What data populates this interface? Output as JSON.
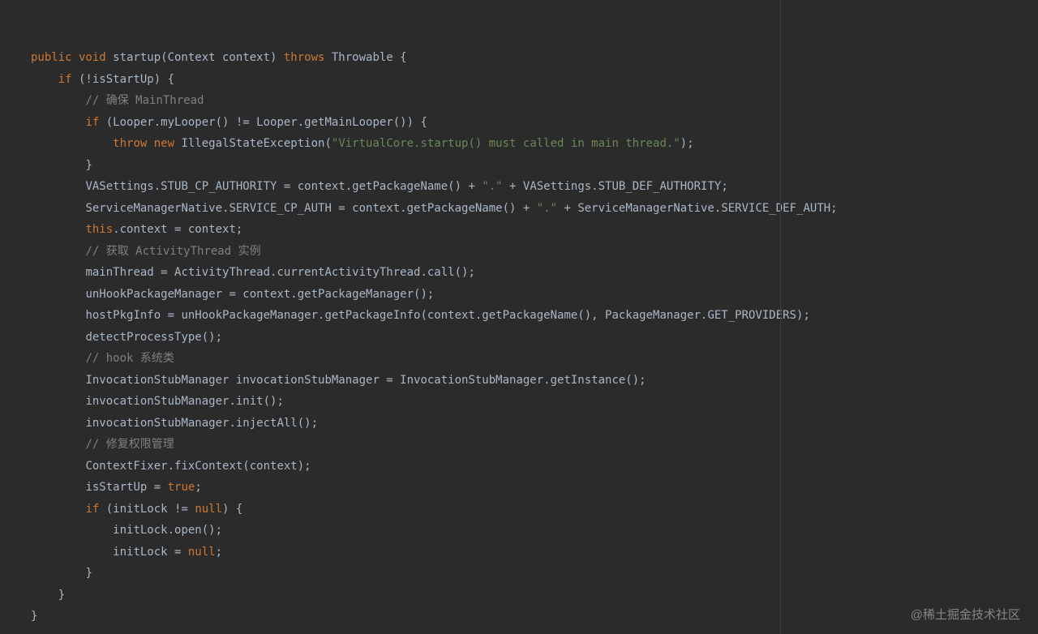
{
  "code": {
    "lines": [
      {
        "i": 0,
        "spans": [
          {
            "c": "kw",
            "t": "public void"
          },
          {
            "c": "id",
            "t": " startup(Context context) "
          },
          {
            "c": "kw",
            "t": "throws"
          },
          {
            "c": "id",
            "t": " Throwable {"
          }
        ]
      },
      {
        "i": 1,
        "spans": [
          {
            "c": "kw",
            "t": "if"
          },
          {
            "c": "id",
            "t": " (!isStartUp) {"
          }
        ]
      },
      {
        "i": 2,
        "spans": [
          {
            "c": "cmt",
            "t": "// 确保 MainThread"
          }
        ]
      },
      {
        "i": 2,
        "spans": [
          {
            "c": "kw",
            "t": "if"
          },
          {
            "c": "id",
            "t": " (Looper.myLooper() != Looper.getMainLooper()) {"
          }
        ]
      },
      {
        "i": 3,
        "spans": [
          {
            "c": "kw",
            "t": "throw new"
          },
          {
            "c": "id",
            "t": " IllegalStateException("
          },
          {
            "c": "str",
            "t": "\"VirtualCore.startup() must called in main thread.\""
          },
          {
            "c": "id",
            "t": ");"
          }
        ]
      },
      {
        "i": 2,
        "spans": [
          {
            "c": "id",
            "t": "}"
          }
        ]
      },
      {
        "i": 2,
        "spans": [
          {
            "c": "id",
            "t": "VASettings.STUB_CP_AUTHORITY = context.getPackageName() + "
          },
          {
            "c": "str",
            "t": "\".\""
          },
          {
            "c": "id",
            "t": " + VASettings.STUB_DEF_AUTHORITY;"
          }
        ]
      },
      {
        "i": 2,
        "spans": [
          {
            "c": "id",
            "t": "ServiceManagerNative.SERVICE_CP_AUTH = context.getPackageName() + "
          },
          {
            "c": "str",
            "t": "\".\""
          },
          {
            "c": "id",
            "t": " + ServiceManagerNative.SERVICE_DEF_AUTH;"
          }
        ]
      },
      {
        "i": 2,
        "spans": [
          {
            "c": "kw",
            "t": "this"
          },
          {
            "c": "id",
            "t": ".context = context;"
          }
        ]
      },
      {
        "i": 2,
        "spans": [
          {
            "c": "cmt",
            "t": "// 获取 ActivityThread 实例"
          }
        ]
      },
      {
        "i": 2,
        "spans": [
          {
            "c": "id",
            "t": "mainThread = ActivityThread.currentActivityThread.call();"
          }
        ]
      },
      {
        "i": 2,
        "spans": [
          {
            "c": "id",
            "t": "unHookPackageManager = context.getPackageManager();"
          }
        ]
      },
      {
        "i": 2,
        "spans": [
          {
            "c": "id",
            "t": "hostPkgInfo = unHookPackageManager.getPackageInfo(context.getPackageName(), PackageManager.GET_PROVIDERS);"
          }
        ]
      },
      {
        "i": 2,
        "spans": [
          {
            "c": "id",
            "t": "detectProcessType();"
          }
        ]
      },
      {
        "i": 2,
        "spans": [
          {
            "c": "cmt",
            "t": "// hook 系统类"
          }
        ]
      },
      {
        "i": 2,
        "spans": [
          {
            "c": "id",
            "t": "InvocationStubManager invocationStubManager = InvocationStubManager.getInstance();"
          }
        ]
      },
      {
        "i": 2,
        "spans": [
          {
            "c": "id",
            "t": "invocationStubManager.init();"
          }
        ]
      },
      {
        "i": 2,
        "spans": [
          {
            "c": "id",
            "t": "invocationStubManager.injectAll();"
          }
        ]
      },
      {
        "i": 2,
        "spans": [
          {
            "c": "cmt",
            "t": "// 修复权限管理"
          }
        ]
      },
      {
        "i": 2,
        "spans": [
          {
            "c": "id",
            "t": "ContextFixer.fixContext(context);"
          }
        ]
      },
      {
        "i": 2,
        "spans": [
          {
            "c": "id",
            "t": "isStartUp = "
          },
          {
            "c": "kw",
            "t": "true"
          },
          {
            "c": "id",
            "t": ";"
          }
        ]
      },
      {
        "i": 2,
        "spans": [
          {
            "c": "kw",
            "t": "if"
          },
          {
            "c": "id",
            "t": " (initLock != "
          },
          {
            "c": "kw",
            "t": "null"
          },
          {
            "c": "id",
            "t": ") {"
          }
        ]
      },
      {
        "i": 3,
        "spans": [
          {
            "c": "id",
            "t": "initLock.open();"
          }
        ]
      },
      {
        "i": 3,
        "spans": [
          {
            "c": "id",
            "t": "initLock = "
          },
          {
            "c": "kw",
            "t": "null"
          },
          {
            "c": "id",
            "t": ";"
          }
        ]
      },
      {
        "i": 2,
        "spans": [
          {
            "c": "id",
            "t": "}"
          }
        ]
      },
      {
        "i": 1,
        "spans": [
          {
            "c": "id",
            "t": "}"
          }
        ]
      },
      {
        "i": 0,
        "spans": [
          {
            "c": "id",
            "t": "}"
          }
        ]
      }
    ]
  },
  "watermark": "@稀土掘金技术社区",
  "indent_unit": "    "
}
